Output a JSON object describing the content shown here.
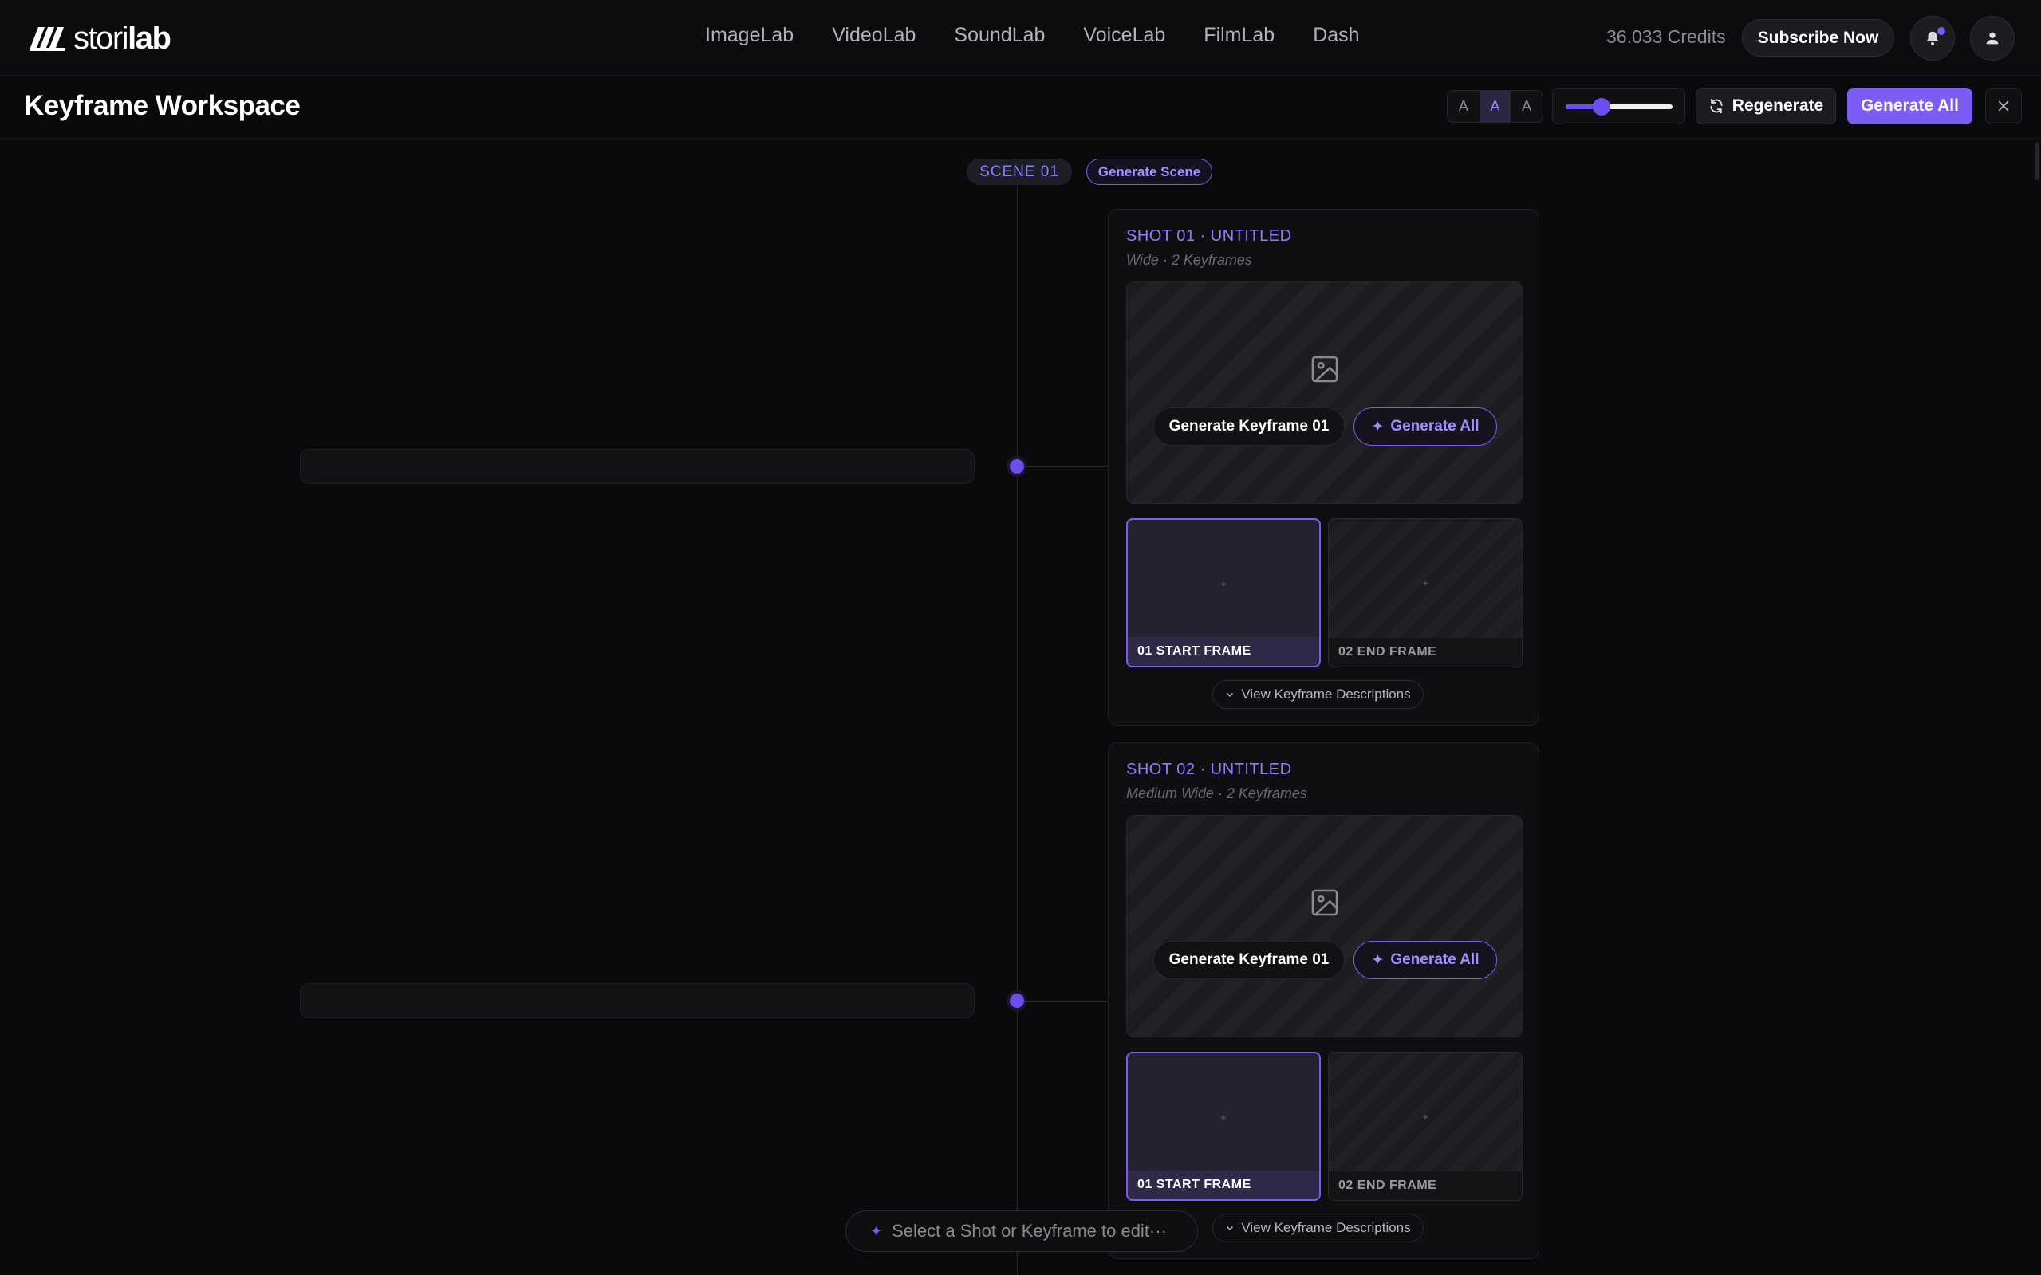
{
  "nav": {
    "logo_prefix": "stori",
    "logo_suffix": "lab",
    "links": [
      "ImageLab",
      "VideoLab",
      "SoundLab",
      "VoiceLab",
      "FilmLab",
      "Dash"
    ],
    "credits": "36.033 Credits",
    "subscribe_label": "Subscribe Now"
  },
  "workspace": {
    "title": "Keyframe Workspace",
    "size_options": [
      "A",
      "A",
      "A"
    ],
    "active_size_index": 1,
    "zoom_level": 0.3,
    "regenerate_label": "Regenerate",
    "generate_all_label": "Generate All"
  },
  "scene": {
    "label": "SCENE 01",
    "generate_label": "Generate Scene"
  },
  "shots": [
    {
      "title": "SHOT 01 · UNTITLED",
      "meta": "Wide · 2 Keyframes",
      "generate_keyframe_label": "Generate Keyframe 01",
      "generate_all_label": "Generate All",
      "frames": [
        "01 START FRAME",
        "02 END FRAME"
      ],
      "view_descriptions_label": "View Keyframe Descriptions"
    },
    {
      "title": "SHOT 02 · UNTITLED",
      "meta": "Medium Wide · 2 Keyframes",
      "generate_keyframe_label": "Generate Keyframe 01",
      "generate_all_label": "Generate All",
      "frames": [
        "01 START FRAME",
        "02 END FRAME"
      ],
      "view_descriptions_label": "View Keyframe Descriptions"
    }
  ],
  "prompt": {
    "placeholder": "Select a Shot or Keyframe to edit···"
  },
  "colors": {
    "accent": "#7c5cf5",
    "accent_text": "#8f7dff",
    "background": "#0a0a0c"
  },
  "icons": [
    "logo-mark-icon",
    "bell-icon",
    "user-icon",
    "refresh-icon",
    "close-icon",
    "image-icon",
    "sparkle-icon",
    "chevron-down-icon"
  ]
}
